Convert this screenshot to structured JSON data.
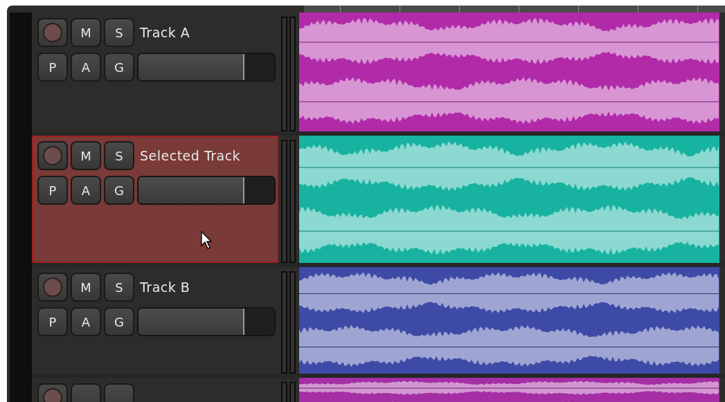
{
  "tracks": [
    {
      "name": "Track A",
      "selected": false,
      "color": "#b12ba9",
      "top_buttons": [
        "M",
        "S"
      ],
      "bottom_buttons": [
        "P",
        "A",
        "G"
      ],
      "fader": {
        "level": 0.78
      }
    },
    {
      "name": "Selected Track",
      "selected": true,
      "color": "#17b3a0",
      "top_buttons": [
        "M",
        "S"
      ],
      "bottom_buttons": [
        "P",
        "A",
        "G"
      ],
      "fader": {
        "level": 0.78
      }
    },
    {
      "name": "Track B",
      "selected": false,
      "color": "#3e4ba6",
      "top_buttons": [
        "M",
        "S"
      ],
      "bottom_buttons": [
        "P",
        "A",
        "G"
      ],
      "fader": {
        "level": 0.78
      }
    }
  ]
}
